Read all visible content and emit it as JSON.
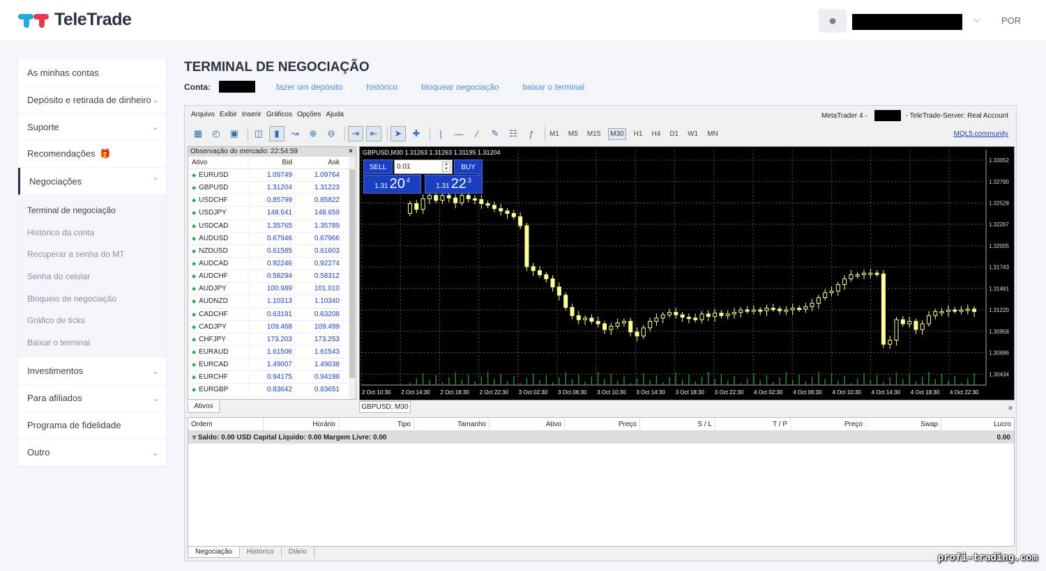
{
  "brand": {
    "name": "TeleTrade"
  },
  "header": {
    "lang": "POR",
    "chevron": "⌵"
  },
  "sidebar": {
    "items": [
      {
        "label": "As minhas contas"
      },
      {
        "label": "Depósito e retirada de dinheiro"
      },
      {
        "label": "Suporte"
      },
      {
        "label": "Recomendações"
      },
      {
        "label": "Negociações"
      }
    ],
    "subitems": [
      "Terminal de negociação",
      "Histórico da conta",
      "Recuperar a senha do MT",
      "Senha do celular",
      "Bloqueio de negociação",
      "Gráfico de ticks",
      "Baixar o terminal"
    ],
    "items2": [
      {
        "label": "Investimentos"
      },
      {
        "label": "Para afiliados"
      },
      {
        "label": "Programa de fidelidade"
      },
      {
        "label": "Outro"
      }
    ]
  },
  "page": {
    "title": "TERMINAL DE NEGOCIAÇÃO",
    "account_label": "Conta:",
    "links": [
      "fazer um depósito",
      "histórico",
      "bloquear negociação",
      "baixar o terminal"
    ]
  },
  "terminal": {
    "menu": [
      "Arquivo",
      "Exibir",
      "Inserir",
      "Gráficos",
      "Opções",
      "Ajuda"
    ],
    "mt4_prefix": "MetaTrader 4 -",
    "mt4_server": "- TeleTrade-Server: Real Account",
    "timeframes": [
      "M1",
      "M5",
      "M15",
      "M30",
      "H1",
      "H4",
      "D1",
      "W1",
      "MN"
    ],
    "selected_timeframe": "M30",
    "mql": "MQL5.community",
    "market_watch": {
      "title": "Observação do mercado: 22:54:59",
      "cols": [
        "Ativo",
        "Bid",
        "Ask"
      ],
      "rows": [
        [
          "EURUSD",
          "1.09749",
          "1.09764"
        ],
        [
          "GBPUSD",
          "1.31204",
          "1.31223"
        ],
        [
          "USDCHF",
          "0.85799",
          "0.85822"
        ],
        [
          "USDJPY",
          "148.641",
          "148.659"
        ],
        [
          "USDCAD",
          "1.35765",
          "1.35789"
        ],
        [
          "AUDUSD",
          "0.67946",
          "0.67966"
        ],
        [
          "NZDUSD",
          "0.61585",
          "0.61603"
        ],
        [
          "AUDCAD",
          "0.92246",
          "0.92274"
        ],
        [
          "AUDCHF",
          "0.58294",
          "0.58312"
        ],
        [
          "AUDJPY",
          "100.989",
          "101.010"
        ],
        [
          "AUDNZD",
          "1.10313",
          "1.10340"
        ],
        [
          "CADCHF",
          "0.63191",
          "0.63208"
        ],
        [
          "CADJPY",
          "109.468",
          "109.499"
        ],
        [
          "CHFJPY",
          "173.203",
          "173.253"
        ],
        [
          "EURAUD",
          "1.61506",
          "1.61543"
        ],
        [
          "EURCAD",
          "1.49007",
          "1.49038"
        ],
        [
          "EURCHF",
          "0.94175",
          "0.94198"
        ],
        [
          "EURGBP",
          "0.83642",
          "0.83651"
        ]
      ],
      "tab": "Ativos"
    },
    "chart": {
      "header": "GBPUSD,M30  1.31263 1.31263 1.31195 1.31204",
      "tab": "GBPUSD, M30",
      "more": "»",
      "one_click": {
        "sell": "SELL",
        "buy": "BUY",
        "lot": "0.01",
        "sell_prefix": "1.31",
        "sell_big": "20",
        "sell_sup": "4",
        "buy_prefix": "1.31",
        "buy_big": "22",
        "buy_sup": "3"
      },
      "price_labels": [
        "1.33052",
        "1.32790",
        "1.32528",
        "1.32267",
        "1.32005",
        "1.31743",
        "1.31481",
        "1.31220",
        "1.30958",
        "1.30696",
        "1.30434"
      ],
      "time_labels": [
        "2 Oct 10:30",
        "2 Oct 14:30",
        "2 Oct 18:30",
        "2 Oct 22:30",
        "3 Oct 02:30",
        "3 Oct 06:30",
        "3 Oct 10:30",
        "3 Oct 14:30",
        "3 Oct 18:30",
        "3 Oct 22:30",
        "4 Oct 02:30",
        "4 Oct 06:30",
        "4 Oct 10:30",
        "4 Oct 14:30",
        "4 Oct 18:30",
        "4 Oct 22:30"
      ],
      "closes": [
        1.3252,
        1.3245,
        1.3258,
        1.3262,
        1.3256,
        1.3262,
        1.3259,
        1.3253,
        1.3262,
        1.3258,
        1.3257,
        1.3252,
        1.325,
        1.3246,
        1.3243,
        1.324,
        1.3236,
        1.3225,
        1.3175,
        1.317,
        1.3165,
        1.316,
        1.315,
        1.314,
        1.3125,
        1.3115,
        1.311,
        1.3112,
        1.3108,
        1.3105,
        1.3098,
        1.3102,
        1.3106,
        1.3108,
        1.3095,
        1.309,
        1.31,
        1.3108,
        1.3112,
        1.3116,
        1.3119,
        1.3116,
        1.3113,
        1.3112,
        1.311,
        1.3117,
        1.3114,
        1.3118,
        1.3115,
        1.3117,
        1.3119,
        1.3122,
        1.3121,
        1.3122,
        1.3121,
        1.3124,
        1.3123,
        1.3121,
        1.3122,
        1.3124,
        1.3123,
        1.3126,
        1.313,
        1.3137,
        1.3143,
        1.3145,
        1.3153,
        1.316,
        1.3165,
        1.3165,
        1.3167,
        1.3167,
        1.3166,
        1.308,
        1.3085,
        1.311,
        1.3105,
        1.3108,
        1.3098,
        1.3105,
        1.3115,
        1.312,
        1.312,
        1.3122,
        1.3121,
        1.3122,
        1.3123,
        1.312
      ]
    },
    "trade": {
      "cols": [
        "Ordem",
        "Horário",
        "Tipo",
        "Tamanho",
        "Ativo",
        "Preço",
        "S / L",
        "T / P",
        "Preço",
        "Swap",
        "Lucro"
      ],
      "balance": "Saldo: 0.00 USD  Capital Líquido: 0.00  Margem Livre: 0.00",
      "profit": "0.00",
      "tabs": [
        "Negociação",
        "Histórico",
        "Diário"
      ]
    }
  },
  "watermark": "profi-trading.com"
}
